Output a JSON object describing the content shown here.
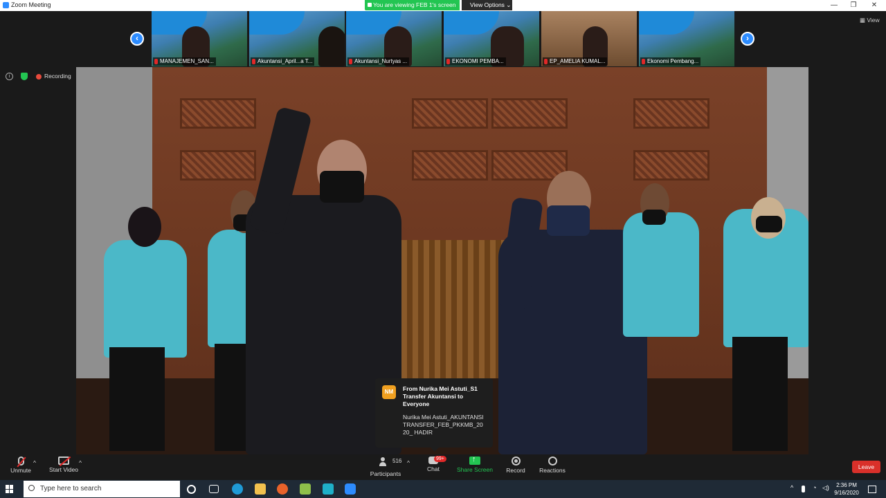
{
  "window": {
    "title": "Zoom Meeting",
    "minimize": "—",
    "maximize": "❐",
    "close": "✕"
  },
  "share_banner": {
    "text": "You are viewing FEB 1's screen",
    "view_options": "View Options ⌄"
  },
  "view_button": "▦ View",
  "status": {
    "info": "i",
    "recording": "Recording"
  },
  "thumbnails": [
    {
      "label": "MANAJEMEN_SAN..."
    },
    {
      "label": "Akuntansi_April...a T..."
    },
    {
      "label": "Akuntansi_Nurtyas ..."
    },
    {
      "label": "EKONOMI PEMBA..."
    },
    {
      "label": "EP_AMELIA KUMAL..."
    },
    {
      "label": "Ekonomi Pembang..."
    }
  ],
  "nav": {
    "prev": "‹",
    "next": "›"
  },
  "chat_popup": {
    "avatar": "NM",
    "from": "From Nurika Mei Astuti_S1 Transfer Akuntansi to Everyone",
    "message": "Nurika Mei Astuti_AKUNTANSI TRANSFER_FEB_PKKMB_2020_ HADIR"
  },
  "toolbar": {
    "unmute": "Unmute",
    "start_video": "Start Video",
    "participants": "Participants",
    "participants_count": "516",
    "chat": "Chat",
    "chat_badge": "99+",
    "share_screen": "Share Screen",
    "record": "Record",
    "reactions": "Reactions",
    "leave": "Leave",
    "caret": "^"
  },
  "taskbar": {
    "search_placeholder": "Type here to search",
    "time": "2:36 PM",
    "date": "9/16/2020"
  },
  "colors": {
    "zoom_blue": "#2d8cff",
    "share_green": "#23c552",
    "leave_red": "#d9302a",
    "toolbar_bg": "#1a1a1a"
  }
}
